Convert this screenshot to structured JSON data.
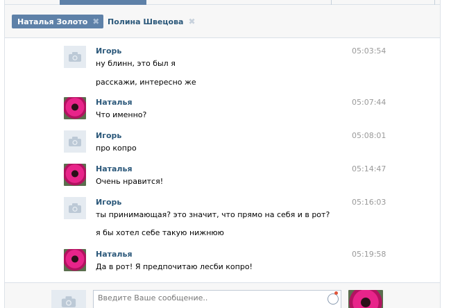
{
  "tabs": [
    {
      "label": "Наталья Золото",
      "active": true
    },
    {
      "label": "Полина Швецова",
      "active": false
    }
  ],
  "messages": [
    {
      "author": "Игорь",
      "avatar": "camera-placeholder",
      "time": "05:03:54",
      "lines": [
        "ну блинн, это был я",
        "расскажи, интересно же"
      ]
    },
    {
      "author": "Наталья",
      "avatar": "photo",
      "time": "05:07:44",
      "lines": [
        "Что именно?"
      ]
    },
    {
      "author": "Игорь",
      "avatar": "camera-placeholder",
      "time": "05:08:01",
      "lines": [
        "про копро"
      ]
    },
    {
      "author": "Наталья",
      "avatar": "photo",
      "time": "05:14:47",
      "lines": [
        "Очень нравится!"
      ]
    },
    {
      "author": "Игорь",
      "avatar": "camera-placeholder",
      "time": "05:16:03",
      "lines": [
        "ты принимающая? это значит, что прямо на себя и в рот?",
        "я бы хотел себе такую нижнюю"
      ]
    },
    {
      "author": "Наталья",
      "avatar": "photo",
      "time": "05:19:58",
      "lines": [
        "Да в рот! Я предпочитаю лесби копро!"
      ]
    }
  ],
  "composer": {
    "placeholder": "Введите Ваше сообщение.."
  },
  "colors": {
    "accent": "#5e81a8",
    "link": "#2b587a",
    "time": "#999999",
    "bg_bar": "#f7f7f7"
  }
}
